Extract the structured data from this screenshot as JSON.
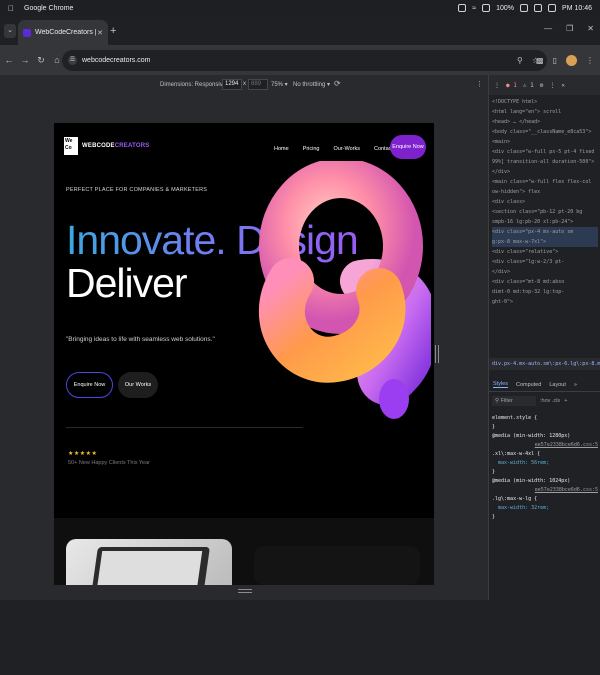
{
  "menubar": {
    "app_name": "Google Chrome",
    "battery": "100%",
    "clock": "PM 10:46"
  },
  "tabs": [
    {
      "title": "WebCodeCreators | Home"
    }
  ],
  "toolbar": {
    "url": "webcodecreators.com"
  },
  "device_toolbar": {
    "dimensions_label": "Dimensions: Responsive",
    "width": "1294",
    "height": "889",
    "zoom": "75%",
    "throttling": "No throttling"
  },
  "site": {
    "logo": {
      "mark": "We Co",
      "word1": "WEBCODE",
      "word2": "CREATORS"
    },
    "nav": [
      "Home",
      "Pricing",
      "Our-Works",
      "Contact"
    ],
    "enquire_top": "Enquire Now",
    "tagline": "PERFECT PLACE FOR COMPANIES & MARKETERS",
    "headline_1": "Innovate. Design",
    "headline_2": "Deliver",
    "quote": "\"Bringing ideas to life with seamless web solutions.\"",
    "btn_enquire": "Enquire Now",
    "btn_works": "Our Works",
    "stars": "★★★★★",
    "clients": "50+ New Happy Clients This Year"
  },
  "devtools": {
    "errors": "1",
    "warnings": "1",
    "dom_lines": [
      "<!DOCTYPE html>",
      "<html lang=\"en\"> scroll",
      "  <head> … </head>",
      "  <body class=\"__className_e8ca53\">",
      "    <main>",
      "      <div class=\"w-full px-5 pt-4 fixed",
      "      99%] transition-all duration-500\">",
      "      </div>",
      "      <main class=\"w-full flex flex-col",
      "      ow-hidden\"> flex",
      "        <div class>",
      "          <section class=\"pb-12 pt-20 bg",
      "          smpb-16 lg:pb-20 xl:pb-24\">",
      "            <div class=\"px-4 mx-auto sm",
      "            g:px-8 max-w-7xl\">",
      "              <div class=\"relative\">",
      "                <div class=\"lg:w-2/3 pt-",
      "                </div>",
      "                <div class=\"mt-8 md:abso",
      "                dimt-0 md:top-32 lg:top-",
      "                ght-0\">"
    ],
    "breadcrumb": "div.px-4.mx-auto.sm\\:px-6.lg\\:px-8.max-w-7xl",
    "tabs": [
      "Styles",
      "Computed",
      "Layout"
    ],
    "filter_placeholder": "Filter",
    "filter_flags": ":hov .cls",
    "style_rules": [
      {
        "selector": "element.style {",
        "props": [],
        "link": ""
      },
      {
        "selector": "@media (min-width: 1280px)",
        "props": [],
        "link": "ee57e2338bce6d6.css:5"
      },
      {
        "selector": ".xl\\:max-w-4xl {",
        "props": [
          "max-width: 56rem;"
        ],
        "link": ""
      },
      {
        "selector": "@media (min-width: 1024px)",
        "props": [],
        "link": "ee57e2338bce6d6.css:5"
      },
      {
        "selector": ".lg\\:max-w-lg {",
        "props": [
          "max-width: 32rem;"
        ],
        "link": ""
      }
    ]
  }
}
